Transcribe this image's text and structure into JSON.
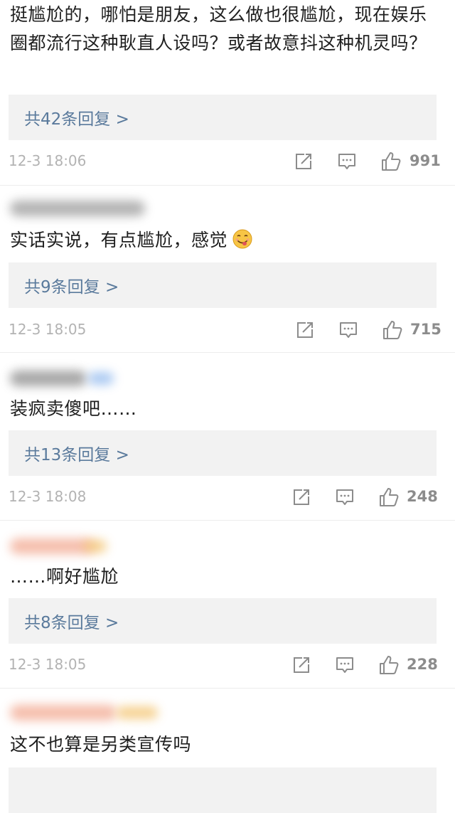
{
  "comments": [
    {
      "text": "挺尴尬的，哪怕是朋友，这么做也很尴尬，现在娱乐圈都流行这种耿直人设吗？或者故意抖这种机灵吗？",
      "replies": "共42条回复 >",
      "time": "12-3 18:06",
      "likes": "991"
    },
    {
      "text": "实话实说，有点尴尬，感觉",
      "emoji": "face-savoring-food-emoji",
      "replies": "共9条回复 >",
      "time": "12-3 18:05",
      "likes": "715"
    },
    {
      "text": "装疯卖傻吧……",
      "replies": "共13条回复 >",
      "time": "12-3 18:08",
      "likes": "248"
    },
    {
      "text": "……啊好尴尬",
      "replies": "共8条回复 >",
      "time": "12-3 18:05",
      "likes": "228"
    },
    {
      "text": "这不也算是另类宣传吗",
      "replies": "",
      "time": "",
      "likes": ""
    }
  ],
  "icons": {
    "share": "share-icon",
    "reply": "comment-icon",
    "like": "thumbs-up-icon"
  },
  "colors": {
    "reply_link": "#5a7a9c",
    "reply_bg": "#f2f2f2",
    "meta_text": "#b3b3b3",
    "icon": "#8c8c8c"
  }
}
